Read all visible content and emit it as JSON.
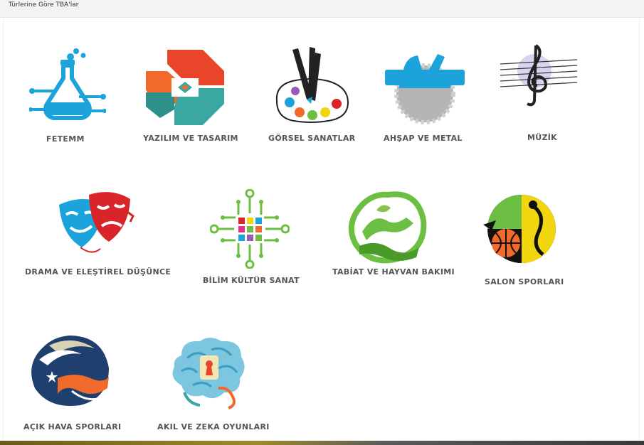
{
  "header": {
    "title": "Türlerine Göre TBA'lar"
  },
  "categories": [
    {
      "label": "FETEMM",
      "icon": "science-flask-icon"
    },
    {
      "label": "YAZILIM VE TASARIM",
      "icon": "software-design-icon"
    },
    {
      "label": "GÖRSEL SANATLAR",
      "icon": "palette-brushes-icon"
    },
    {
      "label": "AHŞAP VE METAL",
      "icon": "saw-plane-icon"
    },
    {
      "label": "MÜZİK",
      "icon": "treble-clef-icon"
    },
    {
      "label": "DRAMA VE ELEŞTİREL DÜŞÜNCE",
      "icon": "theater-masks-icon"
    },
    {
      "label": "BİLİM KÜLTÜR SANAT",
      "icon": "circuit-dots-icon"
    },
    {
      "label": "TABİAT VE HAYVAN BAKIMI",
      "icon": "nature-leaf-icon"
    },
    {
      "label": "SALON SPORLARI",
      "icon": "indoor-sports-ball-icon"
    },
    {
      "label": "AÇIK HAVA SPORLARI",
      "icon": "outdoor-sports-moon-icon"
    },
    {
      "label": "AKIL VE ZEKA OYUNLARI",
      "icon": "brain-keyhole-icon"
    }
  ],
  "colors": {
    "blue": "#1ca3dc",
    "orange": "#f26a2b",
    "teal": "#3aa7a3",
    "green": "#6cbf43",
    "navy": "#1f3f6e",
    "red": "#d9252a",
    "yellow": "#f1d60f",
    "label_gray": "#555555"
  }
}
